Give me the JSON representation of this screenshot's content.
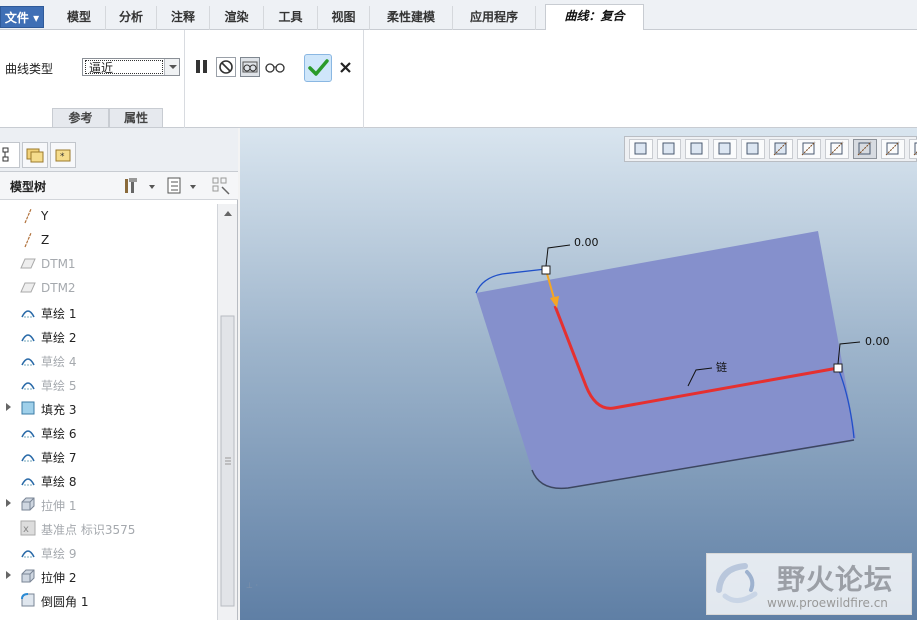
{
  "menu": {
    "file": "文件",
    "tabs": [
      "模型",
      "分析",
      "注释",
      "渲染",
      "工具",
      "视图",
      "柔性建模",
      "应用程序"
    ],
    "active_tab": "曲线：复合"
  },
  "ribbon": {
    "curve_type_label": "曲线类型",
    "curve_type_value": "逼近",
    "subtabs": [
      "参考",
      "属性"
    ]
  },
  "left_panel": {
    "tree_title": "模型树",
    "items": [
      {
        "label": "Y",
        "icon": "axis-icon",
        "dim": false,
        "expandable": false
      },
      {
        "label": "Z",
        "icon": "axis-icon",
        "dim": false,
        "expandable": false
      },
      {
        "label": "DTM1",
        "icon": "datum-plane-icon",
        "dim": true,
        "expandable": false
      },
      {
        "label": "DTM2",
        "icon": "datum-plane-icon",
        "dim": true,
        "expandable": false
      },
      {
        "label": "草绘 1",
        "icon": "sketch-icon",
        "dim": false,
        "expandable": false
      },
      {
        "label": "草绘 2",
        "icon": "sketch-icon",
        "dim": false,
        "expandable": false
      },
      {
        "label": "草绘 4",
        "icon": "sketch-icon",
        "dim": true,
        "expandable": false
      },
      {
        "label": "草绘 5",
        "icon": "sketch-icon",
        "dim": true,
        "expandable": false
      },
      {
        "label": "填充 3",
        "icon": "fill-icon",
        "dim": false,
        "expandable": true
      },
      {
        "label": "草绘 6",
        "icon": "sketch-icon",
        "dim": false,
        "expandable": false
      },
      {
        "label": "草绘 7",
        "icon": "sketch-icon",
        "dim": false,
        "expandable": false
      },
      {
        "label": "草绘 8",
        "icon": "sketch-icon",
        "dim": false,
        "expandable": false
      },
      {
        "label": "拉伸 1",
        "icon": "extrude-icon",
        "dim": true,
        "expandable": true
      },
      {
        "label": "基准点 标识3575",
        "icon": "datum-point-icon",
        "dim": true,
        "expandable": false
      },
      {
        "label": "草绘 9",
        "icon": "sketch-icon",
        "dim": true,
        "expandable": false
      },
      {
        "label": "拉伸 2",
        "icon": "extrude-icon",
        "dim": false,
        "expandable": true
      },
      {
        "label": "倒圆角 1",
        "icon": "round-icon",
        "dim": false,
        "expandable": false
      }
    ]
  },
  "viewport": {
    "dim_start": "0.00",
    "dim_end": "0.00",
    "chain_label": "链",
    "watermark_cn": "野火论坛",
    "watermark_url": "www.proewildfire.cn"
  },
  "colors": {
    "accent_blue": "#3f6fb5",
    "ok_green": "#2a9a2a",
    "surface": "#8590cc",
    "chain_red": "#e53030",
    "edge_blue": "#2050c8"
  }
}
